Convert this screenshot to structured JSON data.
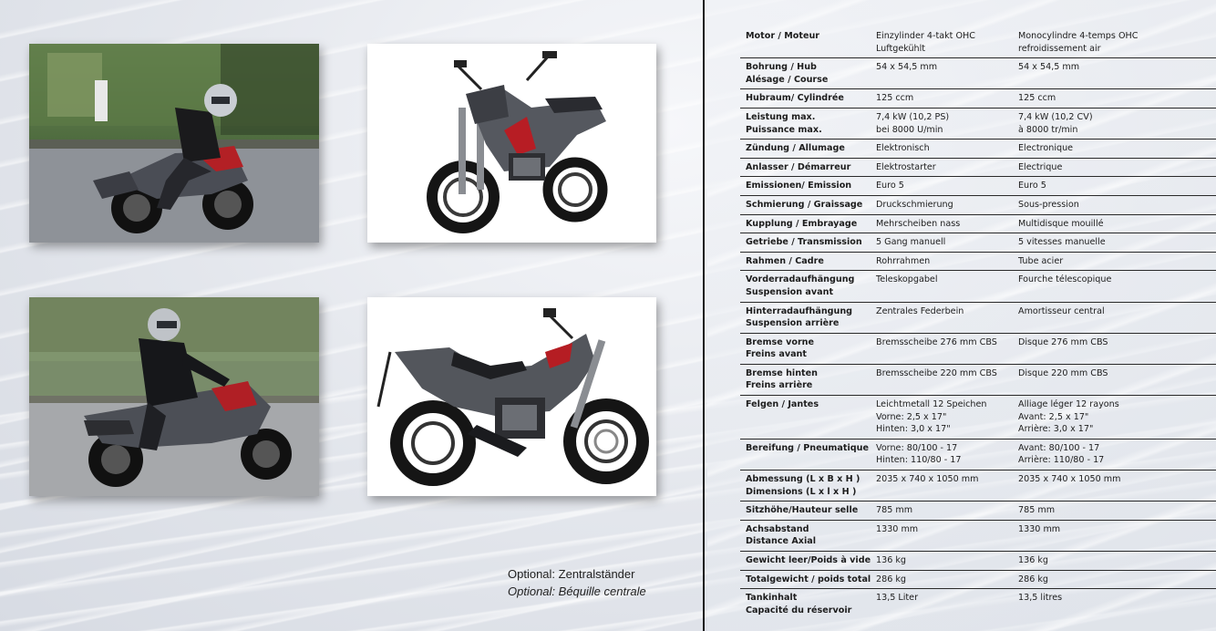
{
  "optional": {
    "line_de": "Optional: Zentralständer",
    "line_fr": "Optional: Béquille centrale"
  },
  "specs": [
    {
      "label": "Motor / Moteur",
      "de": "Einzylinder 4-takt OHC\nLuftgekühlt",
      "fr": "Monocylindre 4-temps OHC\nrefroidissement air"
    },
    {
      "label": "Bohrung / Hub\nAlésage / Course",
      "de": "54 x 54,5 mm",
      "fr": "54 x 54,5 mm"
    },
    {
      "label": "Hubraum/  Cylindrée",
      "de": "125 ccm",
      "fr": "125 ccm"
    },
    {
      "label": "Leistung max.\nPuissance max.",
      "de": "7,4 kW (10,2 PS)\nbei 8000 U/min",
      "fr": "7,4 kW (10,2 CV)\nà 8000 tr/min"
    },
    {
      "label": "Zündung / Allumage",
      "de": "Elektronisch",
      "fr": "Electronique"
    },
    {
      "label": "Anlasser / Démarreur",
      "de": "Elektrostarter",
      "fr": "Electrique"
    },
    {
      "label": "Emissionen/ Emission",
      "de": "Euro 5",
      "fr": "Euro 5"
    },
    {
      "label": "Schmierung / Graissage",
      "de": "Druckschmierung",
      "fr": "Sous-pression"
    },
    {
      "label": "Kupplung / Embrayage",
      "de": "Mehrscheiben nass",
      "fr": "Multidisque mouillé"
    },
    {
      "label": "Getriebe / Transmission",
      "de": "5 Gang manuell",
      "fr": "5 vitesses manuelle"
    },
    {
      "label": "Rahmen / Cadre",
      "de": "Rohrrahmen",
      "fr": "Tube acier"
    },
    {
      "label": "Vorderradaufhängung\nSuspension avant",
      "de": "Teleskopgabel",
      "fr": "Fourche télescopique"
    },
    {
      "label": "Hinterradaufhängung\nSuspension arrière",
      "de": "Zentrales Federbein",
      "fr": "Amortisseur central"
    },
    {
      "label": "Bremse vorne\nFreins avant",
      "de": "Bremsscheibe 276 mm CBS",
      "fr": "Disque 276 mm CBS"
    },
    {
      "label": "Bremse hinten\nFreins arrière",
      "de": "Bremsscheibe 220 mm CBS",
      "fr": "Disque 220 mm CBS"
    },
    {
      "label": "Felgen / Jantes",
      "de": "Leichtmetall 12 Speichen\nVorne: 2,5 x 17\"\nHinten: 3,0 x 17\"",
      "fr": "Alliage léger 12 rayons\nAvant: 2,5 x 17\"\nArrière: 3,0 x 17\""
    },
    {
      "label": "Bereifung / Pneumatique",
      "de": "Vorne: 80/100 - 17\nHinten: 110/80 - 17",
      "fr": "Avant:  80/100 - 17\nArrière: 110/80 - 17"
    },
    {
      "label": "Abmessung  (L x B x H )\nDimensions  (L x l x H )",
      "de": "2035 x 740 x 1050 mm",
      "fr": "2035 x 740 x 1050 mm"
    },
    {
      "label": "Sitzhöhe/Hauteur selle",
      "de": "785 mm",
      "fr": "785 mm"
    },
    {
      "label": "Achsabstand\nDistance Axial",
      "de": "1330 mm",
      "fr": " 1330 mm"
    },
    {
      "label": "Gewicht leer/Poids à vide",
      "de": "136  kg",
      "fr": "136 kg"
    },
    {
      "label": "Totalgewicht / poids total",
      "de": "286 kg",
      "fr": "286 kg"
    },
    {
      "label": "Tankinhalt\nCapacité du réservoir",
      "de": "13,5 Liter",
      "fr": "13,5 litres"
    }
  ]
}
